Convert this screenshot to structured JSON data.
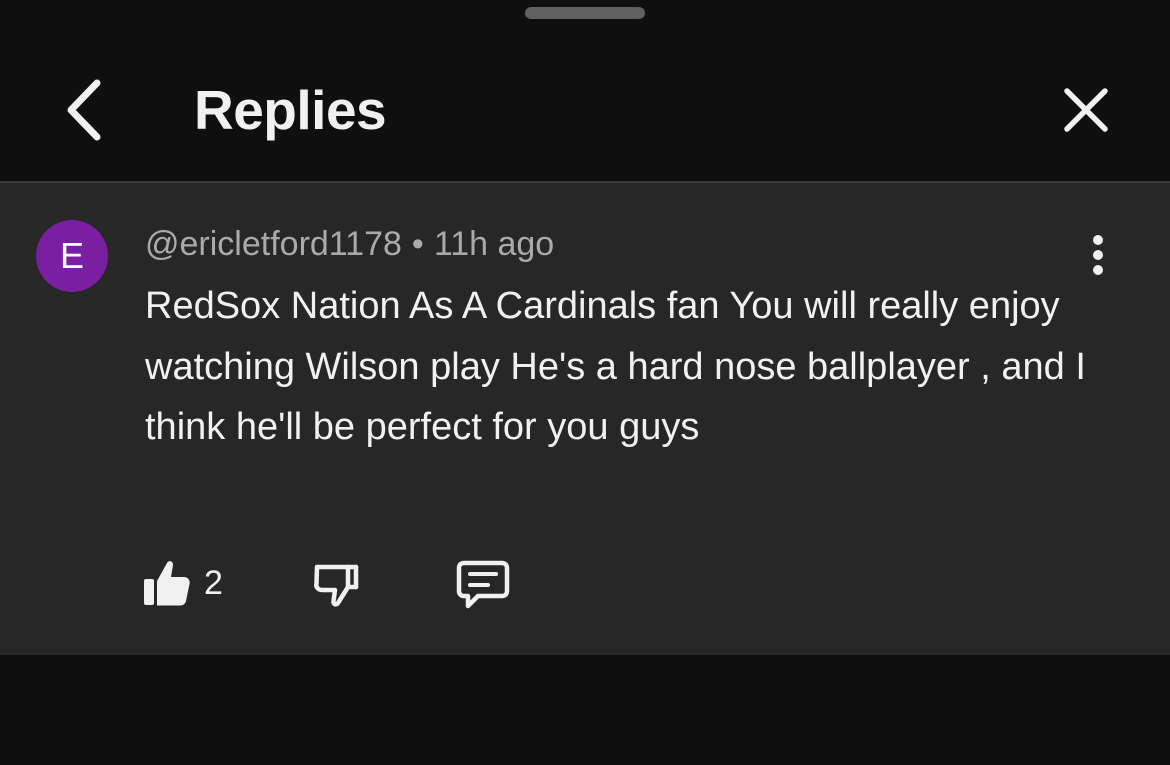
{
  "sheet": {
    "title": "Replies",
    "back_icon": "chevron-left-icon",
    "close_icon": "close-icon"
  },
  "comment": {
    "avatar_letter": "E",
    "avatar_color": "#7b1fa2",
    "author": "@ericletford1178",
    "separator": "•",
    "time": "11h ago",
    "text": "RedSox Nation As A Cardinals fan You will really enjoy watching Wilson play He's a hard nose ballplayer , and I think he'll be perfect for you guys",
    "like_count": "2",
    "icons": {
      "like": "thumbs-up-icon",
      "dislike": "thumbs-down-icon",
      "reply": "comment-icon",
      "more": "more-vertical-icon"
    }
  },
  "colors": {
    "background": "#0f0f0f",
    "comment_background": "#272727",
    "primary_text": "#f1f1f1",
    "secondary_text": "#aaaaaa"
  }
}
